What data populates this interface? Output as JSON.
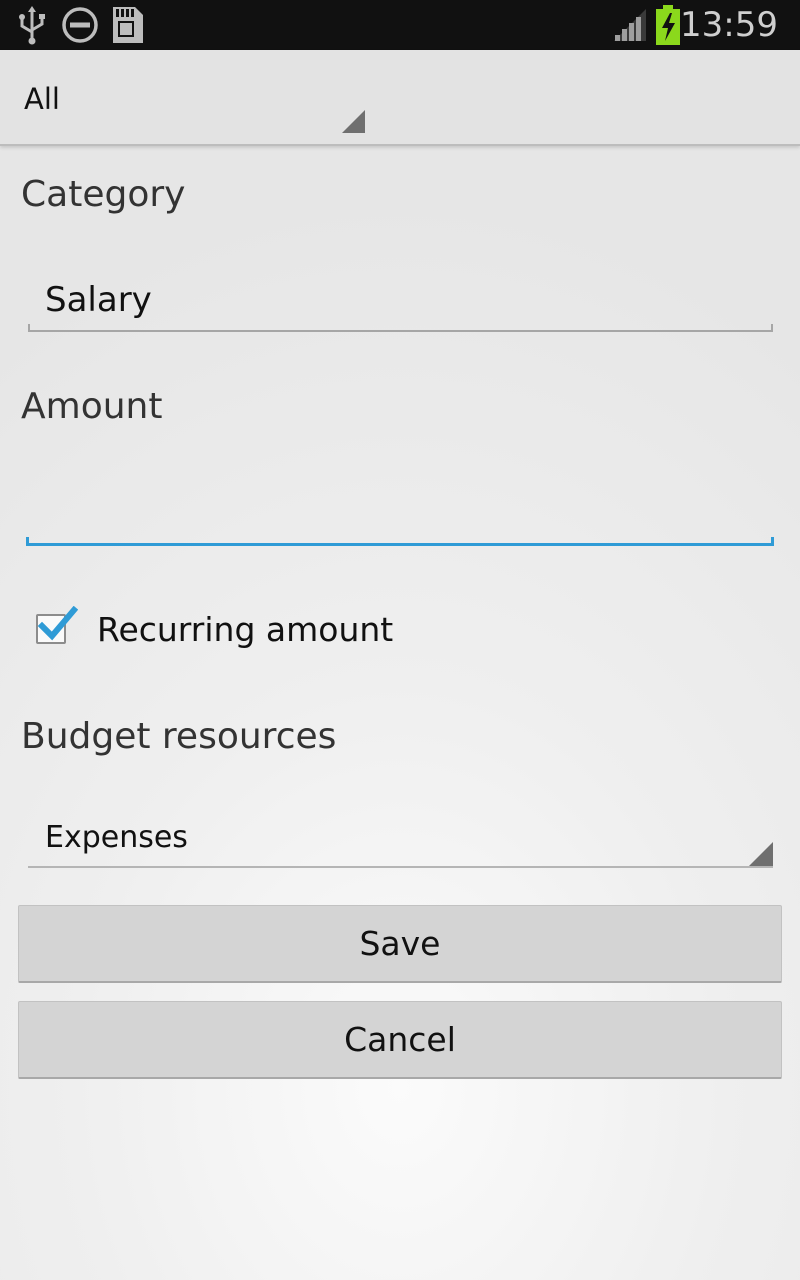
{
  "status_bar": {
    "time": "13:59",
    "icons": [
      "usb-icon",
      "do-not-disturb-icon",
      "sd-card-icon",
      "signal-icon",
      "battery-charging-icon"
    ],
    "battery_color": "#8bd81c"
  },
  "top_spinner": {
    "selected": "All"
  },
  "form": {
    "category": {
      "label": "Category",
      "value": "Salary"
    },
    "amount": {
      "label": "Amount",
      "value": "",
      "accent": "#2f9bd6"
    },
    "recurring": {
      "label": "Recurring amount",
      "checked": true
    },
    "budget": {
      "label": "Budget resources",
      "selected": "Expenses"
    }
  },
  "buttons": {
    "save": "Save",
    "cancel": "Cancel"
  }
}
